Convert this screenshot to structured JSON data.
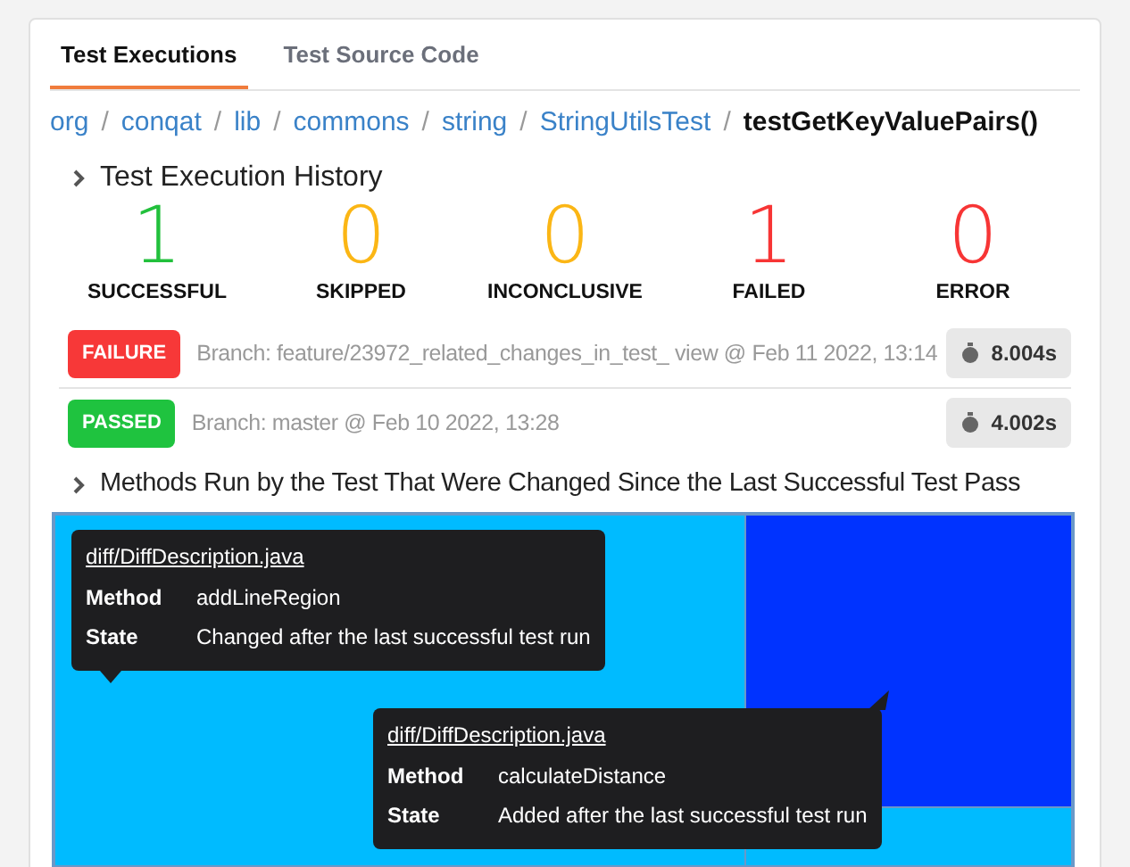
{
  "tabs": [
    {
      "label": "Test Executions",
      "selected": true
    },
    {
      "label": "Test Source Code",
      "selected": false
    }
  ],
  "breadcrumb": [
    {
      "label": "org",
      "current": false
    },
    {
      "label": "conqat",
      "current": false
    },
    {
      "label": "lib",
      "current": false
    },
    {
      "label": "commons",
      "current": false
    },
    {
      "label": "string",
      "current": false
    },
    {
      "label": "StringUtilsTest",
      "current": false
    },
    {
      "label": "testGetKeyValuePairs()",
      "current": true
    }
  ],
  "separator": "/",
  "history": {
    "title": "Test Execution History",
    "expanded": false,
    "counts": [
      {
        "value": "1",
        "label": "SUCCESSFUL",
        "color": "#22c03c"
      },
      {
        "value": "0",
        "label": "SKIPPED",
        "color": "#fbb615"
      },
      {
        "value": "0",
        "label": "INCONCLUSIVE",
        "color": "#fbb615"
      },
      {
        "value": "1",
        "label": "FAILED",
        "color": "#f73535"
      },
      {
        "value": "0",
        "label": "ERROR",
        "color": "#f73535"
      }
    ],
    "runs": [
      {
        "status": "FAILURE",
        "color": "#f73838",
        "branch": "Branch: feature/23972_related_changes_in_test_ view @ Feb 11 2022, 13:14",
        "duration": "8.004s"
      },
      {
        "status": "PASSED",
        "color": "#1fc33f",
        "branch": "Branch: master @ Feb 10 2022, 13:28",
        "duration": "4.002s"
      }
    ]
  },
  "methods": {
    "title": "Methods Run by the Test That Were Changed Since the Last Successful Test Pass",
    "expanded": false,
    "treemap": [
      {
        "color": "#00bbff"
      },
      {
        "color": "#0033ff"
      },
      {
        "color": "#00bbff"
      }
    ],
    "tooltips": [
      {
        "file": "diff/DiffDescription.java",
        "rows": [
          {
            "key": "Method",
            "value": "addLineRegion"
          },
          {
            "key": "State",
            "value": "Changed after the last successful test run"
          }
        ]
      },
      {
        "file": "diff/DiffDescription.java",
        "rows": [
          {
            "key": "Method",
            "value": "calculateDistance"
          },
          {
            "key": "State",
            "value": "Added after the last successful test run"
          }
        ]
      }
    ]
  }
}
